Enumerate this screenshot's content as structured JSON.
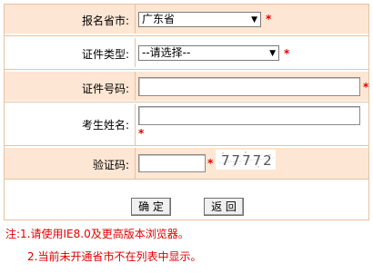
{
  "form": {
    "province": {
      "label": "报名省市:",
      "value": "广东省",
      "required": "*"
    },
    "id_type": {
      "label": "证件类型:",
      "value": "--请选择--",
      "required": "*"
    },
    "id_number": {
      "label": "证件号码:",
      "value": "",
      "required": "*"
    },
    "name": {
      "label": "考生姓名:",
      "value": "",
      "required": "*"
    },
    "captcha": {
      "label": "验证码:",
      "value": "",
      "required": "*",
      "image_text": "77772"
    }
  },
  "buttons": {
    "confirm": "确 定",
    "back": "返 回"
  },
  "notes": {
    "line1": "注:1.请使用IE8.0及更高版本浏览器。",
    "line2": "2.当前未开通省市不在列表中显示。"
  },
  "colors": {
    "row_tint": "#fde6d3",
    "border": "#e5c2a2",
    "required": "#e00000"
  }
}
